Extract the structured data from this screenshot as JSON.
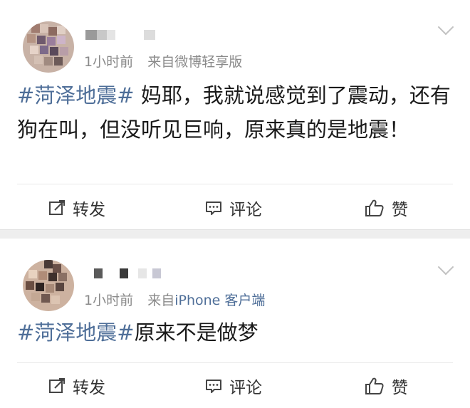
{
  "posts": [
    {
      "meta_time": "1小时前",
      "meta_from": "来自",
      "meta_source": "微博轻享版",
      "hashtag": "#菏泽地震#",
      "text": "妈耶，我就说感觉到了震动，还有狗在叫，但没听见巨响，原来真的是地震！",
      "actions": {
        "repost": "转发",
        "comment": "评论",
        "like": "赞"
      }
    },
    {
      "meta_time": "1小时前",
      "meta_from": "来自",
      "meta_source": "iPhone 客户端",
      "hashtag": "#菏泽地震#",
      "text": "原来不是做梦",
      "actions": {
        "repost": "转发",
        "comment": "评论",
        "like": "赞"
      }
    }
  ],
  "colors": {
    "hashtag": "#4e6e98",
    "meta": "#8a8a8a",
    "separator": "#eeeeee"
  },
  "icons": [
    "chevron-down-icon",
    "repost-icon",
    "comment-icon",
    "like-icon"
  ]
}
